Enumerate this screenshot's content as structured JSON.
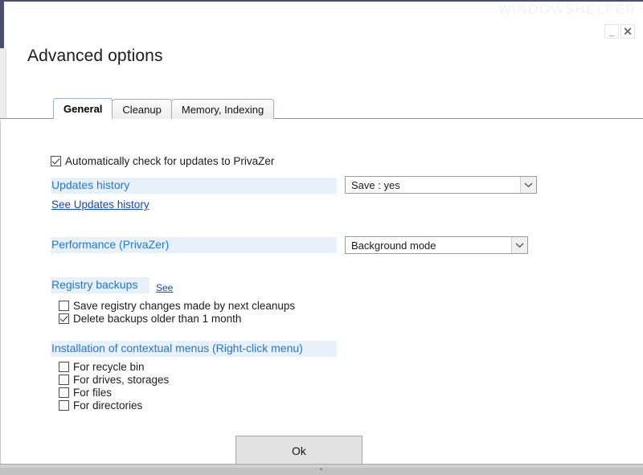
{
  "window": {
    "watermark": "WINDOWSHELPER",
    "title": "Advanced options",
    "minimize_label": "_",
    "close_label": "✕"
  },
  "tabs": [
    {
      "label": "General",
      "active": true
    },
    {
      "label": "Cleanup",
      "active": false
    },
    {
      "label": "Memory, Indexing",
      "active": false
    }
  ],
  "general": {
    "auto_update_checkbox": {
      "label": "Automatically check for updates to PrivaZer",
      "checked": true
    },
    "updates_history": {
      "heading": "Updates history",
      "link": "See Updates history",
      "dropdown_value": "Save : yes"
    },
    "performance": {
      "heading": "Performance (PrivaZer)",
      "dropdown_value": "Background mode"
    },
    "registry_backups": {
      "heading": "Registry backups",
      "see_link": "See",
      "options": [
        {
          "label": "Save registry changes made by next cleanups",
          "checked": false
        },
        {
          "label": "Delete backups older than 1 month",
          "checked": true
        }
      ]
    },
    "contextual_menus": {
      "heading": "Installation of contextual menus (Right-click menu)",
      "options": [
        {
          "label": "For recycle bin",
          "checked": false
        },
        {
          "label": "For drives, storages",
          "checked": false
        },
        {
          "label": "For files",
          "checked": false
        },
        {
          "label": "For directories",
          "checked": false
        }
      ]
    }
  },
  "footer": {
    "ok_label": "Ok"
  },
  "colors": {
    "accent_blue": "#1f78d1",
    "link_blue": "#1549b5",
    "band_blue": "#e8f0fa",
    "tab_border": "#9ab0c6",
    "chrome_navy": "#4a4f6e"
  }
}
